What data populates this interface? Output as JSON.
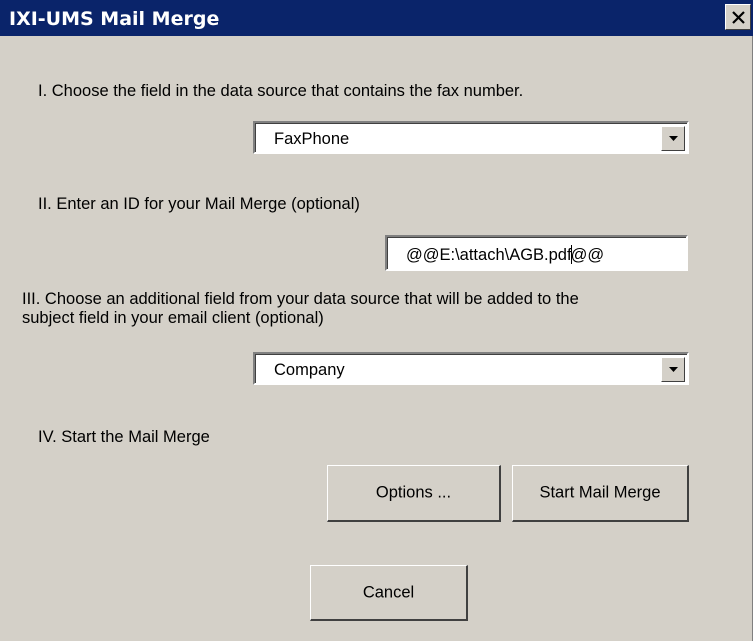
{
  "window": {
    "title": "IXI-UMS Mail Merge"
  },
  "steps": {
    "step1_label": "I.  Choose the field in the data source that contains the fax number.",
    "step2_label": "II.  Enter an ID for your Mail Merge (optional)",
    "step3_label_line1": "III. Choose an additional field from your data source that will be added to the",
    "step3_label_line2": "subject field in your email client (optional)",
    "step4_label": "IV.  Start the Mail Merge"
  },
  "fields": {
    "fax_field_value": "FaxPhone",
    "merge_id_before_caret": "@@E:\\attach\\AGB.pdf",
    "merge_id_after_caret": "@@",
    "subject_field_value": "Company"
  },
  "buttons": {
    "options": "Options ...",
    "start": "Start Mail Merge",
    "cancel": "Cancel"
  }
}
